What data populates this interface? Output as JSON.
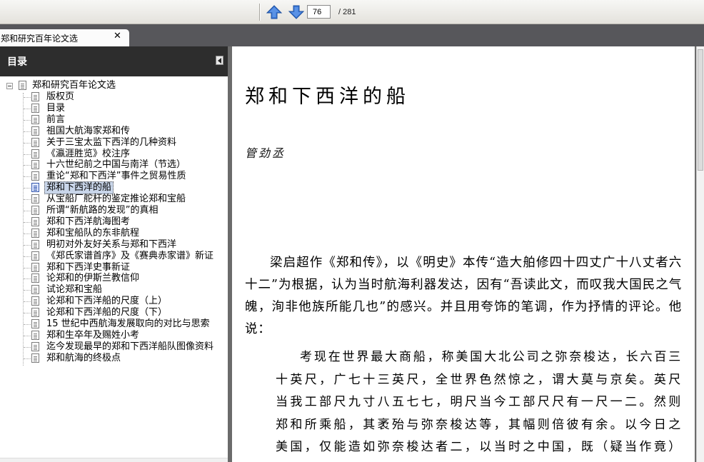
{
  "toolbar": {
    "current_page": "76",
    "total_pages": "/ 281",
    "prev_icon": "arrow-up-icon",
    "next_icon": "arrow-down-icon"
  },
  "tab": {
    "title": "郑和研究百年论文选",
    "close_label": "✕"
  },
  "sidebar": {
    "title": "目录",
    "root": "郑和研究百年论文选",
    "items": [
      "版权页",
      "目录",
      "前言",
      "祖国大航海家郑和传",
      "关于三宝太监下西洋的几种资料",
      "《瀛涯胜览》校注序",
      "十六世纪前之中国与南洋（节选）",
      "重论“郑和下西洋”事件之贸易性质",
      "郑和下西洋的船",
      "从宝船厂舵杆的鉴定推论郑和宝船",
      "所谓“新航路的发现”的真相",
      "郑和下西洋航海图考",
      "郑和宝船队的东非航程",
      "明初对外友好关系与郑和下西洋",
      "《郑氏家谱首序》及《赛典赤家谱》新证",
      "郑和下西洋史事新证",
      "论郑和的伊斯兰教信仰",
      "试论郑和宝船",
      "论郑和下西洋船的尺度（上）",
      "论郑和下西洋船的尺度（下）",
      "15 世纪中西航海发展取向的对比与思索",
      "郑和生卒年及赐姓小考",
      "迄今发现最早的郑和下西洋船队图像资料",
      "郑和航海的终极点"
    ],
    "selected_index": 8
  },
  "document": {
    "title": "郑和下西洋的船",
    "author": "管劲丞",
    "paragraph": "梁启超作《郑和传》，以《明史》本传“造大舶修四十四丈广十八丈者六十二”为根据，认为当时航海利器发达，因有“吾读此文，而叹我大国民之气魄，洵非他族所能几也”的感兴。并且用夸饰的笔调，作为抒情的评论。他说：",
    "quote": "考现在世界最大商船，称美国大北公司之弥奈梭达，长六百三十英尺，广七十三英尺，全世界色然惊之，谓大莫与京矣。英尺当我工部尺九寸八五七七，明尺当今工部尺尺有一尺一二。然则郑和所乘船，其袤殆与弥奈梭达等，其幅则倍彼有余。以今日之美国，仅能造如弥奈梭达者二，以当时之中国，既（疑当作竟）能造倍"
  }
}
